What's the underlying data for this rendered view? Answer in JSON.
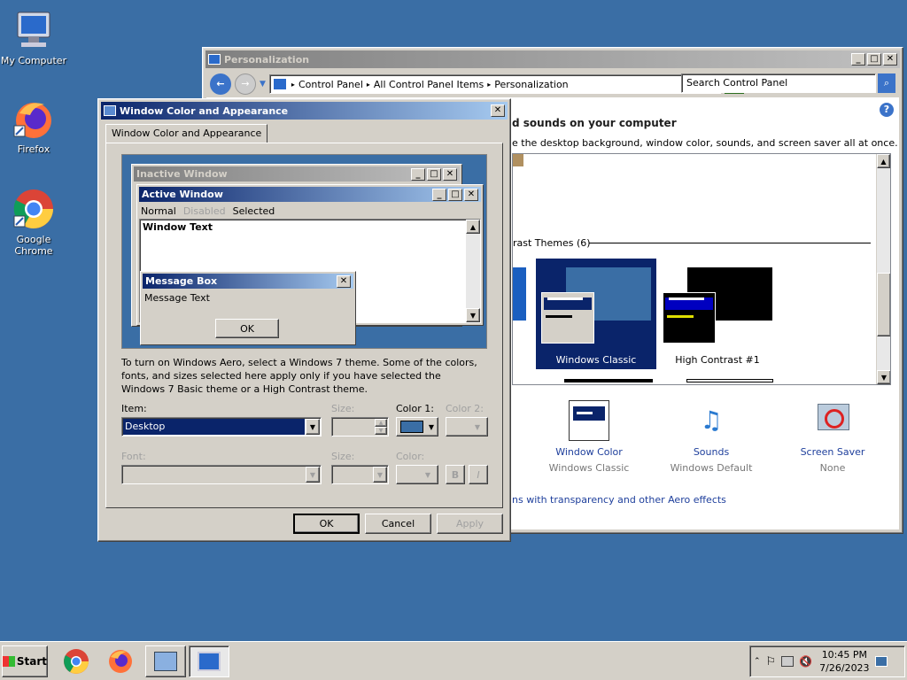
{
  "desktop": {
    "icons": [
      {
        "label": "My Computer"
      },
      {
        "label": "Firefox"
      },
      {
        "label": "Google Chrome"
      }
    ]
  },
  "personalization": {
    "title": "Personalization",
    "breadcrumbs": [
      "Control Panel",
      "All Control Panel Items",
      "Personalization"
    ],
    "search_placeholder": "Search Control Panel",
    "heading": "d sounds on your computer",
    "subheading": "e the desktop background, window color, sounds, and screen saver all at once.",
    "section_label": "rast Themes (6)",
    "themes": [
      {
        "name": "Windows Classic"
      },
      {
        "name": "High Contrast #1"
      }
    ],
    "bottom_items": [
      {
        "label": "Window Color",
        "sub": "Windows Classic"
      },
      {
        "label": "Sounds",
        "sub": "Windows Default"
      },
      {
        "label": "Screen Saver",
        "sub": "None"
      }
    ],
    "aero_link": "ns with transparency and other Aero effects"
  },
  "dialog": {
    "title": "Window Color and Appearance",
    "tab_label": "Window Color and Appearance",
    "preview": {
      "inactive_title": "Inactive Window",
      "active_title": "Active Window",
      "menu_normal": "Normal",
      "menu_disabled": "Disabled",
      "menu_selected": "Selected",
      "window_text": "Window Text",
      "msgbox_title": "Message Box",
      "msgbox_text": "Message Text",
      "msgbox_ok": "OK"
    },
    "info_text": "To turn on Windows Aero, select a Windows 7 theme.  Some of the colors, fonts, and sizes selected here apply only if you have selected the Windows 7 Basic theme or a High Contrast theme.",
    "item_label": "Item:",
    "item_value": "Desktop",
    "size_label": "Size:",
    "color1_label": "Color 1:",
    "color2_label": "Color 2:",
    "font_label": "Font:",
    "size2_label": "Size:",
    "color_label": "Color:",
    "bold_label": "B",
    "italic_label": "I",
    "ok_label": "OK",
    "cancel_label": "Cancel",
    "apply_label": "Apply",
    "color1_value": "#3a6ea5"
  },
  "taskbar": {
    "start_label": "Start",
    "time": "10:45 PM",
    "date": "7/26/2023"
  }
}
